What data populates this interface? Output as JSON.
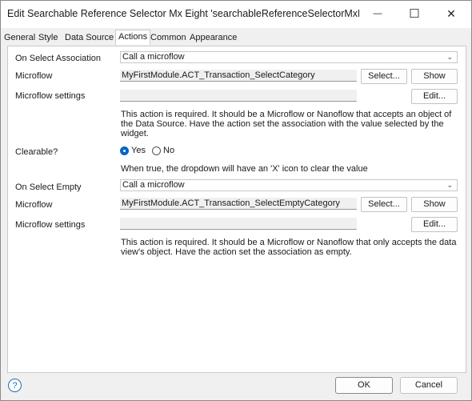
{
  "window": {
    "title": "Edit Searchable Reference Selector Mx Eight 'searchableReferenceSelectorMxEigt...",
    "minimize_glyph": "—",
    "maximize_glyph": "☐",
    "close_glyph": "✕"
  },
  "tabs": [
    {
      "label": "General"
    },
    {
      "label": "Style"
    },
    {
      "label": "Data Source"
    },
    {
      "label": "Actions"
    },
    {
      "label": "Common"
    },
    {
      "label": "Appearance"
    }
  ],
  "form": {
    "on_select_association": {
      "label": "On Select Association",
      "value": "Call a microflow"
    },
    "microflow1": {
      "label": "Microflow",
      "value": "MyFirstModule.ACT_Transaction_SelectCategory",
      "select_label": "Select...",
      "show_label": "Show"
    },
    "microflow_settings1": {
      "label": "Microflow settings",
      "value": "",
      "edit_label": "Edit..."
    },
    "help1": "This action is required. It should be a Microflow or Nanoflow that accepts an object of the Data Source. Have the action set the association with the value selected by the widget.",
    "clearable": {
      "label": "Clearable?",
      "yes": "Yes",
      "no": "No",
      "selected": "Yes"
    },
    "help_clearable": "When true, the dropdown will have an 'X' icon to clear the value",
    "on_select_empty": {
      "label": "On Select Empty",
      "value": "Call a microflow"
    },
    "microflow2": {
      "label": "Microflow",
      "value": "MyFirstModule.ACT_Transaction_SelectEmptyCategory",
      "select_label": "Select...",
      "show_label": "Show"
    },
    "microflow_settings2": {
      "label": "Microflow settings",
      "value": "",
      "edit_label": "Edit..."
    },
    "help2": "This action is required. It should be a Microflow or Nanoflow that only accepts the data view's object. Have the action set the association as empty."
  },
  "footer": {
    "help_glyph": "?",
    "ok_label": "OK",
    "cancel_label": "Cancel"
  },
  "colors": {
    "accent": "#0067c0",
    "help_icon": "#1f6fb5"
  }
}
